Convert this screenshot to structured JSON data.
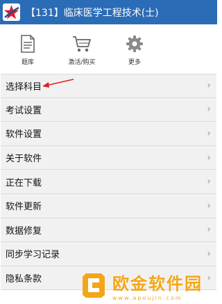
{
  "header": {
    "title": "【131】临床医学工程技术(士)",
    "logo_icon": "star-logo-icon"
  },
  "toolbar": {
    "items": [
      {
        "label": "题库",
        "icon": "document-icon"
      },
      {
        "label": "激活/购买",
        "icon": "cart-icon"
      },
      {
        "label": "更多",
        "icon": "gear-icon"
      }
    ]
  },
  "menu": {
    "items": [
      {
        "label": "选择科目"
      },
      {
        "label": "考试设置"
      },
      {
        "label": "软件设置"
      },
      {
        "label": "关于软件"
      },
      {
        "label": "正在下载"
      },
      {
        "label": "软件更新"
      },
      {
        "label": "数据修复"
      },
      {
        "label": "同步学习记录"
      },
      {
        "label": "隐私条款"
      }
    ],
    "chevron": "›"
  },
  "watermark": {
    "text": "欧金软件园",
    "url": "www.apoujin.com"
  },
  "colors": {
    "titlebar": "#2b6cb6",
    "menu_bg": "#f1f1f1",
    "arrow": "#e02020",
    "watermark": "#f4a619"
  }
}
